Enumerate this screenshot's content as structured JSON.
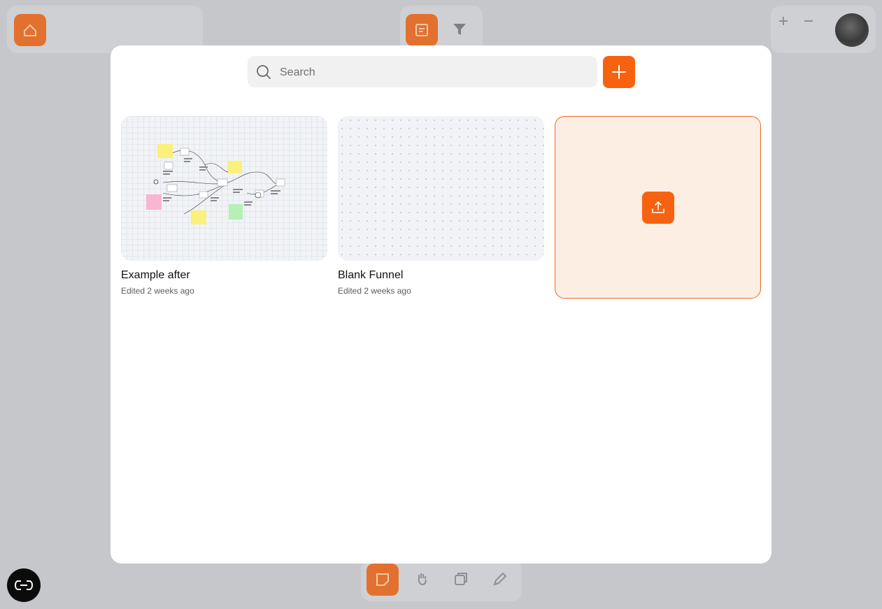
{
  "search": {
    "placeholder": "Search",
    "value": ""
  },
  "toolbar": {
    "add_icon": "plus-icon"
  },
  "boards": [
    {
      "title": "Example after",
      "subtitle": "Edited 2 weeks ago",
      "thumbnail": "funnel-diagram"
    },
    {
      "title": "Blank Funnel",
      "subtitle": "Edited 2 weeks ago",
      "thumbnail": "blank-dotted-canvas"
    }
  ],
  "upload": {
    "icon": "upload-icon"
  },
  "background": {
    "top_left_icon": "home-icon",
    "top_center_icons": [
      "note-icon",
      "funnel-icon"
    ],
    "top_right_icons": [
      "plus-icon",
      "minus-icon",
      "avatar"
    ],
    "bottom_toolbar_icons": [
      "sticky-note-icon",
      "hand-icon",
      "layers-icon",
      "pencil-icon"
    ]
  },
  "help": {
    "icon": "help-icon"
  },
  "colors": {
    "accent": "#f6620f",
    "upload_bg": "#fdeee4",
    "backdrop": "#c6c7ca"
  }
}
